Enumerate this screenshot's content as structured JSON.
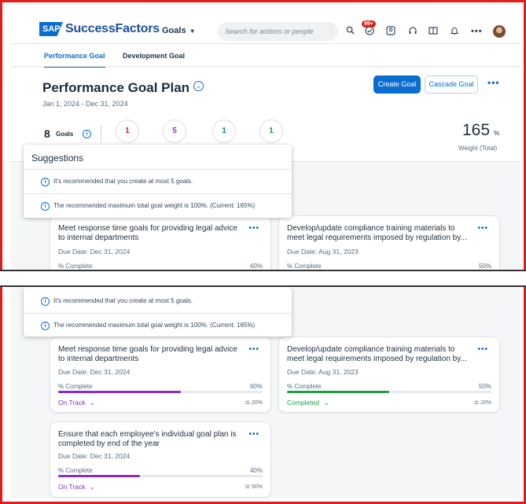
{
  "header": {
    "logo_badge": "SAP",
    "logo_text": "SuccessFactors",
    "module_menu": "Goals",
    "search_placeholder": "Search for actions or people",
    "notification_badge": "99+"
  },
  "tabs": [
    "Performance Goal",
    "Development Goal"
  ],
  "plan": {
    "title": "Performance Goal Plan",
    "dates": "Jan 1, 2024 - Dec 31, 2024",
    "create_goal": "Create Goal",
    "cascade_goal": "Cascade Goal",
    "goal_count": "8",
    "goal_count_label": "Goals",
    "status_counts": [
      "1",
      "5",
      "1",
      "1"
    ],
    "weight_value": "165",
    "weight_unit": "%",
    "weight_label": "Weight (Total)"
  },
  "suggestions": {
    "title": "Suggestions",
    "items": [
      "It's recommended that you create at most 5 goals.",
      "The recommended maximum total goal weight is 100%. (Current: 165%)"
    ]
  },
  "goals": [
    {
      "title": "Meet response time goals for providing legal advice to internal departments",
      "due": "Due Date: Dec 31, 2024",
      "pct_label": "% Complete",
      "pct_value": "60%",
      "progress": 0.6,
      "status": "On Track",
      "weight": "20%"
    },
    {
      "title": "Develop/update compliance training materials to meet legal requirements imposed by regulation by...",
      "due": "Due Date: Aug 31, 2023",
      "pct_label": "% Complete",
      "pct_value": "50%",
      "progress": 0.5,
      "status": "Completed",
      "weight": "20%"
    },
    {
      "title": "Ensure that each employee's individual goal plan is completed by end of the year",
      "due": "Due Date: Dec 31, 2024",
      "pct_label": "% Complete",
      "pct_value": "40%",
      "progress": 0.4,
      "status": "On Track",
      "weight": "50%"
    }
  ],
  "colors": {
    "accent": "#0a6ed1",
    "on_track": "#8b2cc4",
    "completed": "#1e9e3e",
    "frame": "#e31b1b"
  }
}
